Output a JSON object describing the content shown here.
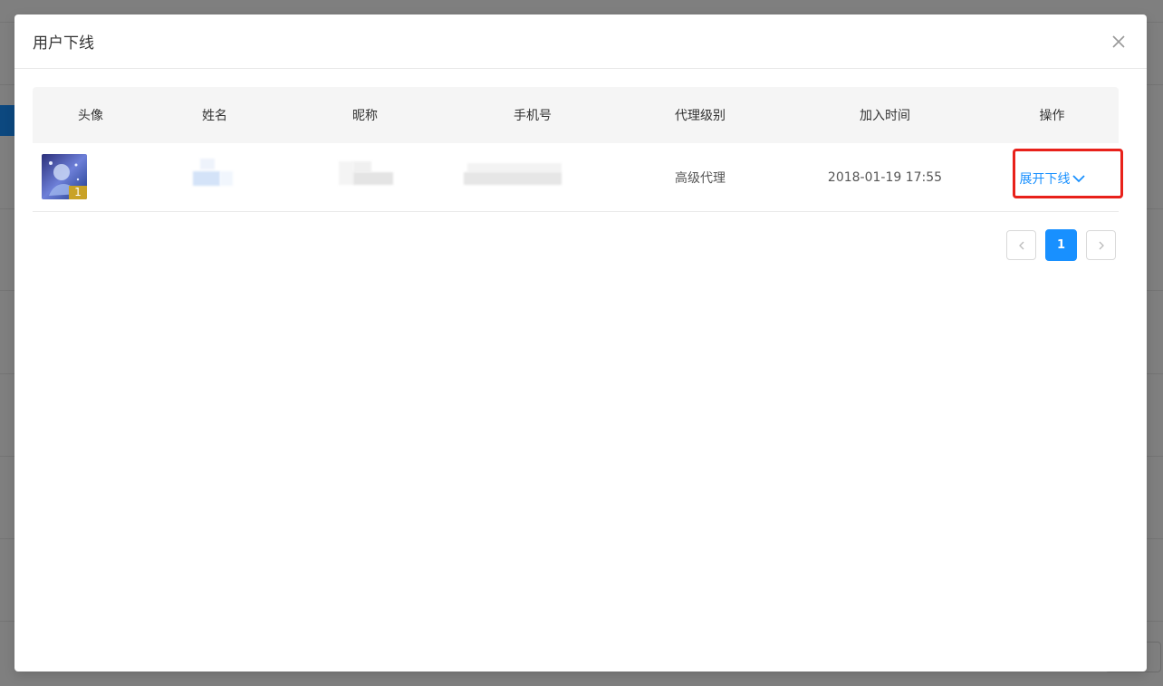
{
  "modal": {
    "title": "用户下线"
  },
  "table": {
    "headers": [
      "头像",
      "姓名",
      "昵称",
      "手机号",
      "代理级别",
      "加入时间",
      "操作"
    ],
    "rows": [
      {
        "avatar_badge": "1",
        "agent_level": "高级代理",
        "join_time": "2018-01-19 17:55",
        "action_label": "展开下线"
      }
    ]
  },
  "pagination": {
    "current_page": "1",
    "prev_icon": "chevron-left-icon",
    "next_icon": "chevron-right-icon"
  },
  "colors": {
    "accent": "#1890ff",
    "highlight": "#e8211b",
    "badge": "#c9a227"
  }
}
